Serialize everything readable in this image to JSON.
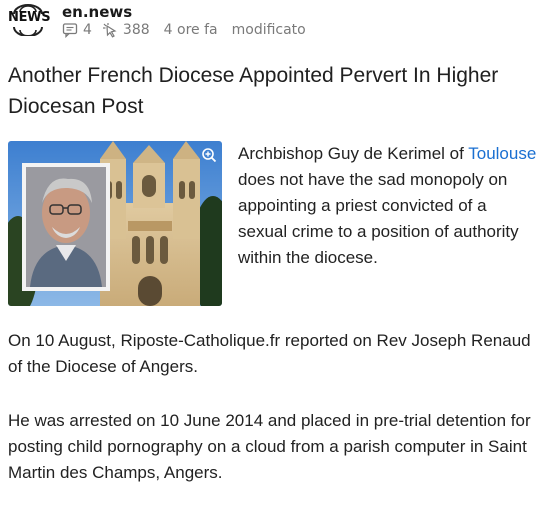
{
  "header": {
    "logo_text": "NEWS",
    "source": "en.news",
    "comments": "4",
    "views": "388",
    "time": "4 ore fa",
    "edited": "modificato"
  },
  "article": {
    "title": "Another French Diocese Appointed Pervert In Higher Diocesan Post",
    "intro": {
      "before": "Archbishop Guy de Kerimel of ",
      "link": "Toulouse",
      "after": " does not have the sad monopoly on appointing a priest convicted of a sexual crime to a position of authority within the diocese."
    },
    "paragraph2": "On 10 August, Riposte-Catholique.fr reported on Rev Joseph Renaud of the Diocese of Angers.",
    "paragraph3": "He was arrested on 10 June 2014 and placed in pre-trial detention for posting child pornography on a cloud from a parish computer in Saint Martin des Champs, Angers."
  },
  "icons": {
    "logo": "globe-logo-icon",
    "comments": "comment-icon",
    "views": "cursor-icon",
    "zoom": "zoom-in-icon"
  },
  "colors": {
    "link": "#1a6fd1",
    "meta": "#7a7a7a"
  }
}
